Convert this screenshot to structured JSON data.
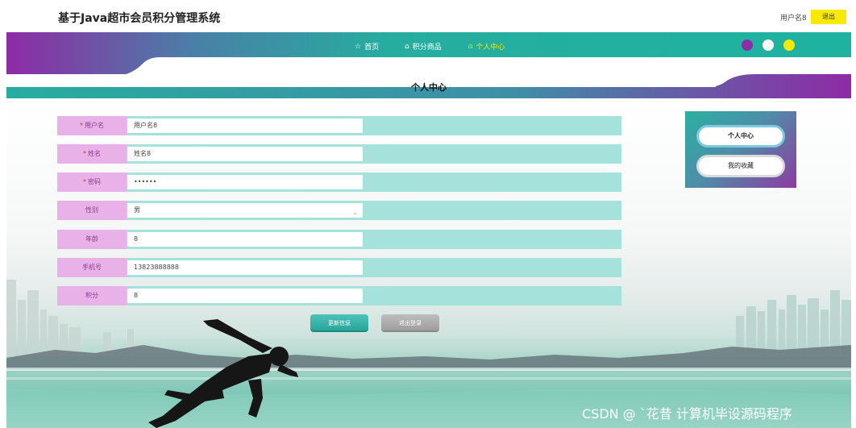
{
  "header": {
    "site_title": "基于Java超市会员积分管理系统",
    "user_name": "用户名8",
    "logout_label": "退出"
  },
  "nav": {
    "items": [
      {
        "label": "首页",
        "icon": "star-icon"
      },
      {
        "label": "积分商品",
        "icon": "home-icon"
      },
      {
        "label": "个人中心",
        "icon": "person-icon",
        "active": true
      }
    ],
    "theme_colors": [
      "#8e2ba6",
      "#ffffff",
      "#f7ea00"
    ]
  },
  "section_title": "个人中心",
  "form": {
    "fields": [
      {
        "label": "用户名",
        "required": true,
        "value": "用户名8",
        "type": "text"
      },
      {
        "label": "姓名",
        "required": true,
        "value": "姓名8",
        "type": "text"
      },
      {
        "label": "密码",
        "required": true,
        "value": "••••••",
        "type": "password"
      },
      {
        "label": "性别",
        "required": false,
        "value": "男",
        "type": "select"
      },
      {
        "label": "年龄",
        "required": false,
        "value": "8",
        "type": "text"
      },
      {
        "label": "手机号",
        "required": false,
        "value": "13823888888",
        "type": "text"
      },
      {
        "label": "积分",
        "required": false,
        "value": "8",
        "type": "text"
      }
    ],
    "update_label": "更新信息",
    "logout_label": "退出登录"
  },
  "side_menu": {
    "items": [
      "个人中心",
      "我的收藏"
    ]
  },
  "watermark": "CSDN @ `花昔 计算机毕设源码程序"
}
